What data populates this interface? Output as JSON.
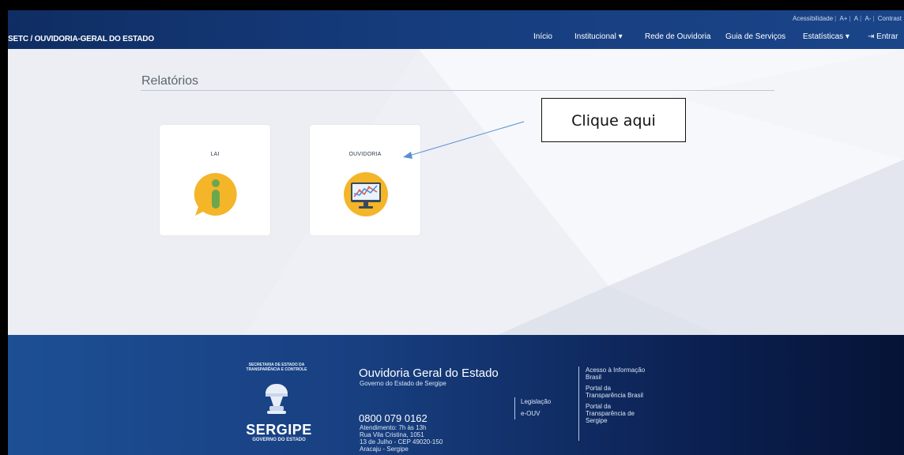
{
  "header": {
    "brand": "SETC / OUVIDORIA-GERAL DO ESTADO",
    "accessibility": {
      "label": "Acessibilidade",
      "increase": "A+",
      "normal": "A",
      "decrease": "A-",
      "contrast": "Contrast"
    },
    "nav": {
      "inicio": "Início",
      "institucional": "Institucional ▾",
      "rede": "Rede de Ouvidoria",
      "guia": "Guia de Serviços",
      "estatisticas": "Estatísticas ▾",
      "entrar": "Entrar"
    }
  },
  "main": {
    "title": "Relatórios",
    "cards": [
      {
        "label": "LAI",
        "icon": "info-speech-bubble-icon"
      },
      {
        "label": "OUVIDORIA",
        "icon": "monitor-chart-icon"
      }
    ],
    "callout": "Clique aqui"
  },
  "footer": {
    "secretaria": "SECRETARIA DE ESTADO DA TRANSPARÊNCIA E CONTROLE",
    "sergipe": "SERGIPE",
    "governo": "GOVERNO DO ESTADO",
    "title": "Ouvidoria Geral do Estado",
    "subtitle": "Governo do Estado de Sergipe",
    "phone": "0800 079 0162",
    "atendimento": "Atendimento: 7h às 13h",
    "rua": "Rua Vila Cristina, 1051",
    "bairro": "13 de Julho - CEP 49020-150",
    "cidade": "Aracaju - Sergipe",
    "links_col1": [
      "Legislação",
      "e-OUV"
    ],
    "links_col2": [
      {
        "line1": "Acesso à Informação",
        "line2": "Brasil"
      },
      {
        "line1": "Portal da",
        "line2": "Transparência Brasil"
      },
      {
        "line1": "Portal da",
        "line2": "Transparência de",
        "line3": "Sergipe"
      }
    ]
  },
  "colors": {
    "header_bg": "#163c7d",
    "footer_bg": "#0c2254",
    "icon_yellow": "#f5b529",
    "icon_green": "#6aa84f"
  }
}
